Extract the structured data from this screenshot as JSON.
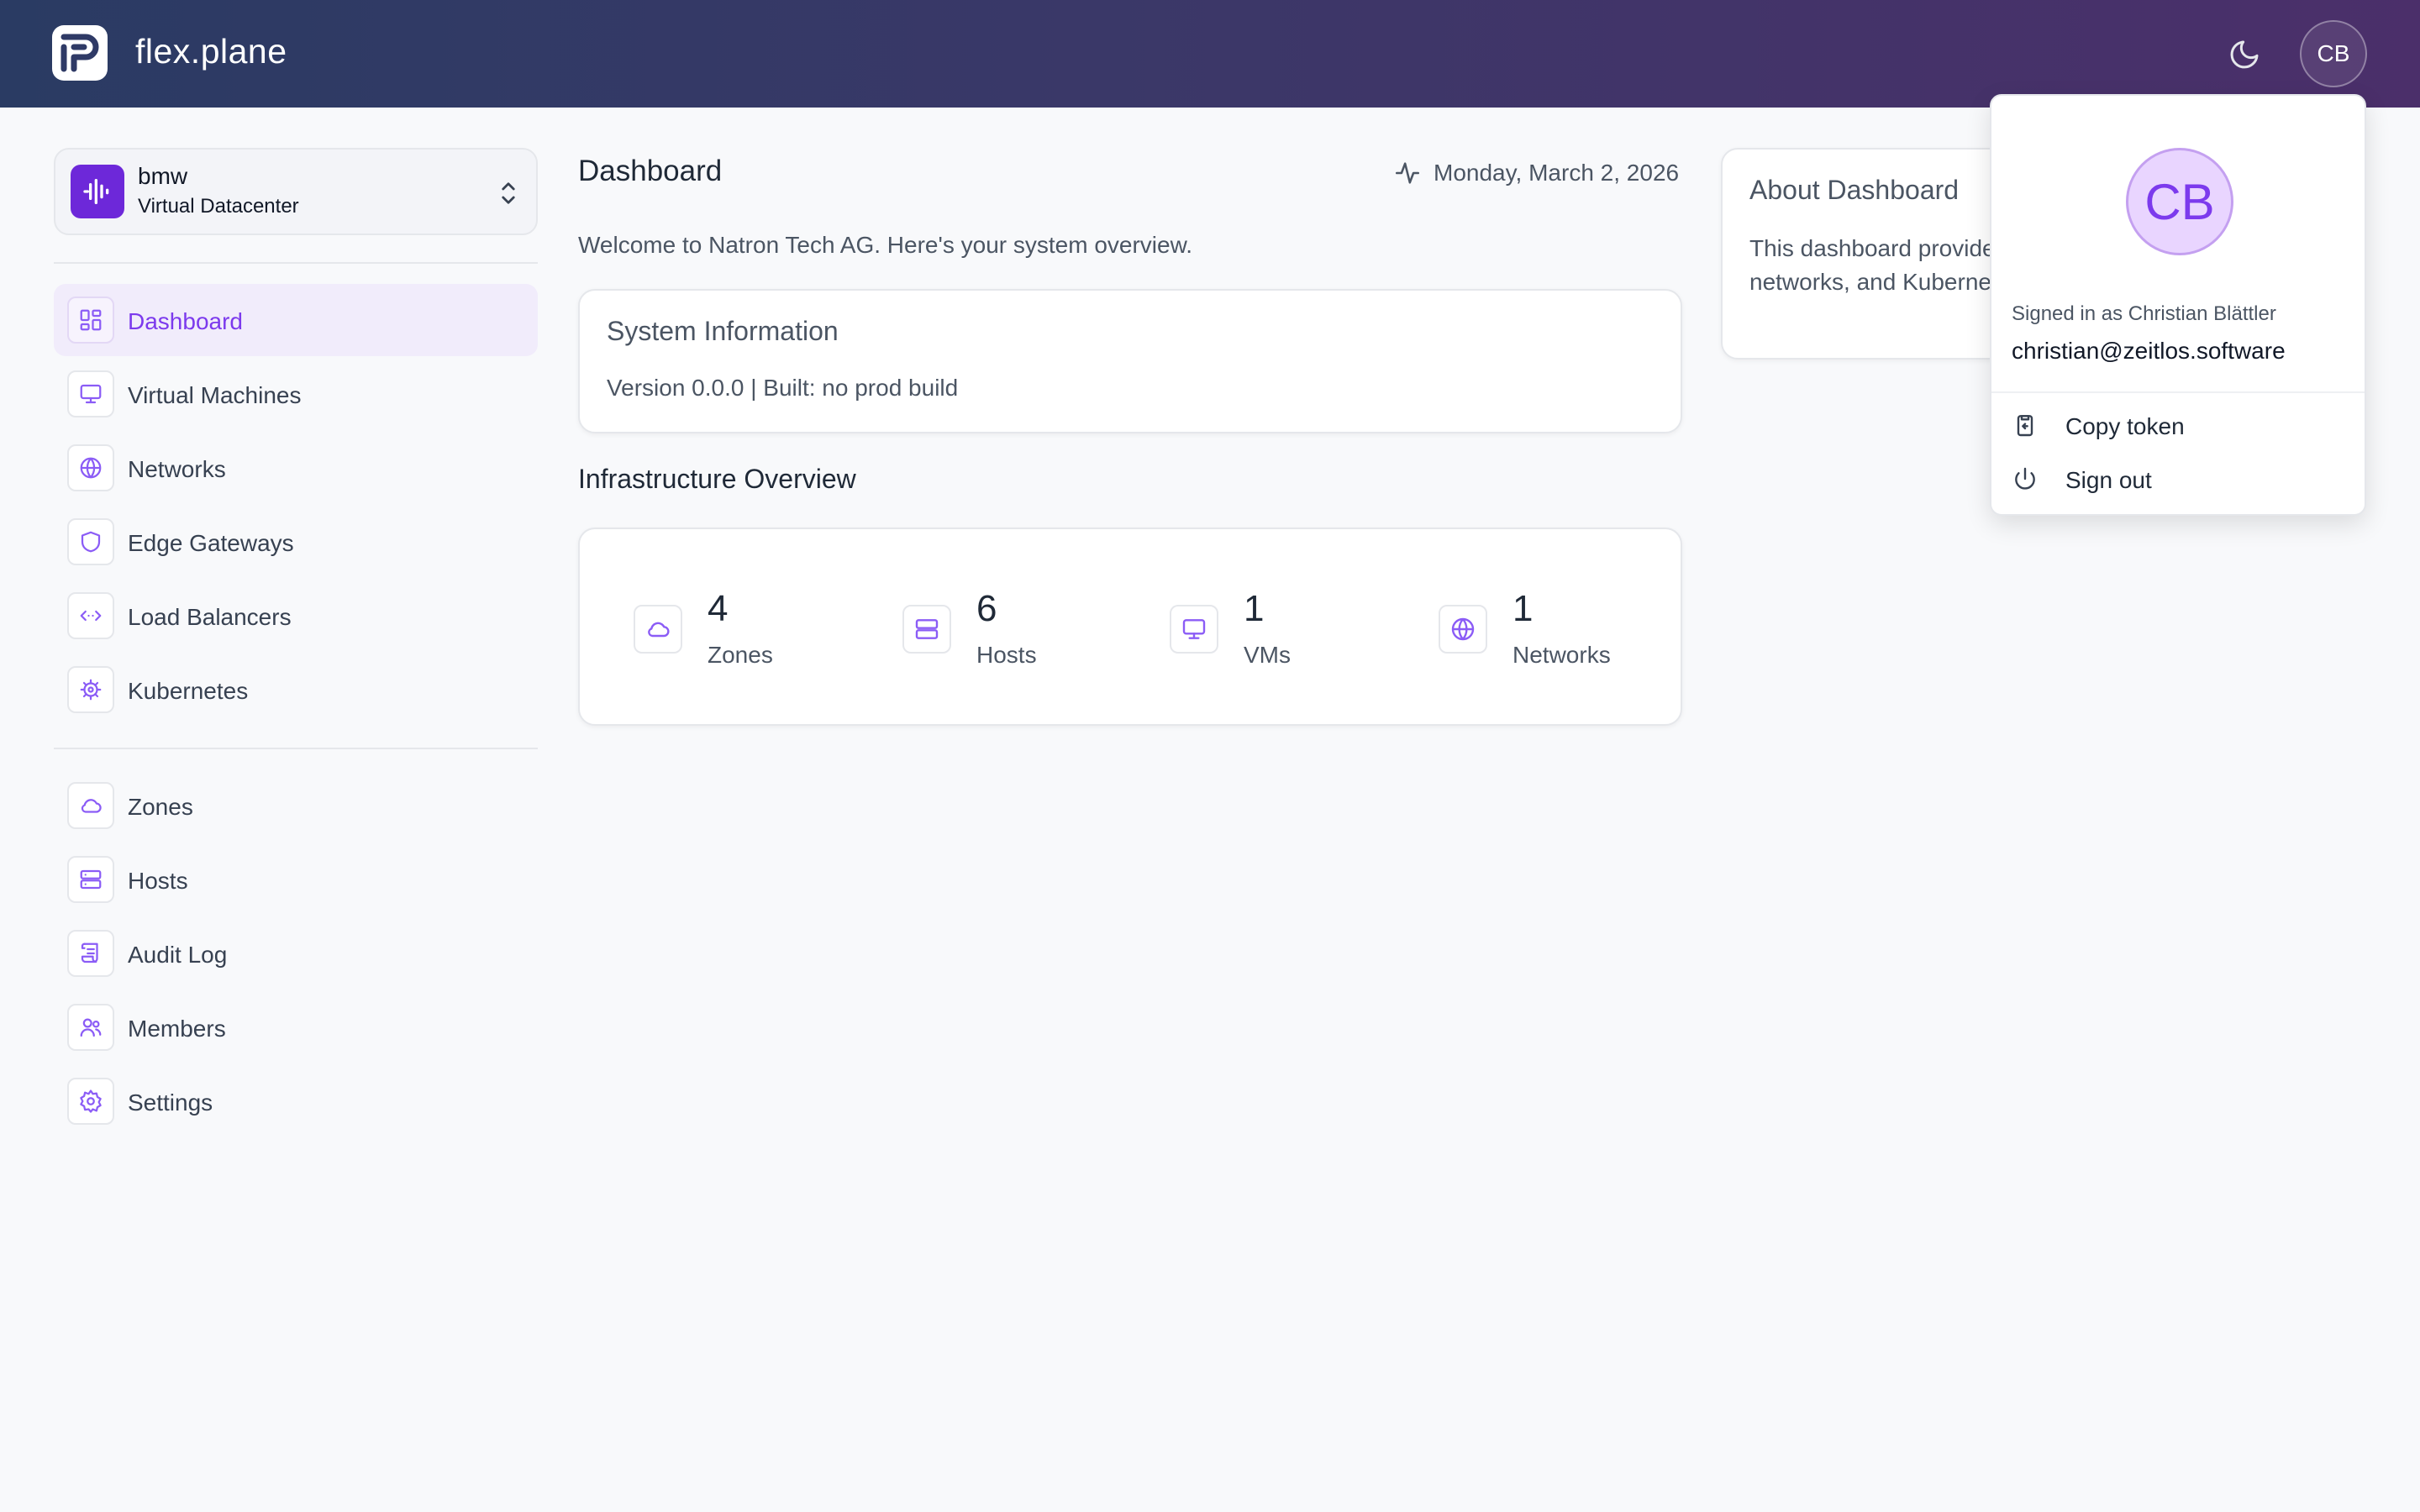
{
  "app": {
    "brand": "flex.plane"
  },
  "header": {
    "avatar_initials": "CB"
  },
  "vdc": {
    "name": "bmw",
    "type": "Virtual Datacenter"
  },
  "nav": {
    "primary": [
      {
        "label": "Dashboard",
        "icon": "dashboard-icon",
        "active": true
      },
      {
        "label": "Virtual Machines",
        "icon": "monitor-icon"
      },
      {
        "label": "Networks",
        "icon": "globe-icon"
      },
      {
        "label": "Edge Gateways",
        "icon": "shield-icon"
      },
      {
        "label": "Load Balancers",
        "icon": "code-arrows-icon"
      },
      {
        "label": "Kubernetes",
        "icon": "helm-icon"
      }
    ],
    "secondary": [
      {
        "label": "Zones",
        "icon": "cloud-icon"
      },
      {
        "label": "Hosts",
        "icon": "server-icon"
      },
      {
        "label": "Audit Log",
        "icon": "scroll-icon"
      },
      {
        "label": "Members",
        "icon": "users-icon"
      },
      {
        "label": "Settings",
        "icon": "gear-icon"
      }
    ]
  },
  "main": {
    "title": "Dashboard",
    "date": "Monday, March 2, 2026",
    "welcome": "Welcome to Natron Tech AG. Here's your system overview.",
    "system_info": {
      "title": "System Information",
      "version": "Version 0.0.0 | Built: no prod build"
    },
    "infra": {
      "title": "Infrastructure Overview",
      "stats": [
        {
          "value": "4",
          "label": "Zones",
          "icon": "cloud-icon"
        },
        {
          "value": "6",
          "label": "Hosts",
          "icon": "server-icon"
        },
        {
          "value": "1",
          "label": "VMs",
          "icon": "monitor-icon"
        },
        {
          "value": "1",
          "label": "Networks",
          "icon": "globe-icon"
        }
      ]
    },
    "about": {
      "title": "About Dashboard",
      "text": "This dashboard provide infrastructure. Monitor y networks, and Kuberne"
    }
  },
  "user_menu": {
    "initials": "CB",
    "signed_in": "Signed in as Christian Blättler",
    "email": "christian@zeitlos.software",
    "items": [
      {
        "label": "Copy token",
        "icon": "clipboard-icon"
      },
      {
        "label": "Sign out",
        "icon": "power-icon"
      }
    ]
  },
  "colors": {
    "accent": "#7c3aed",
    "header_start": "#2a3b63",
    "header_end": "#4b2f6a"
  }
}
